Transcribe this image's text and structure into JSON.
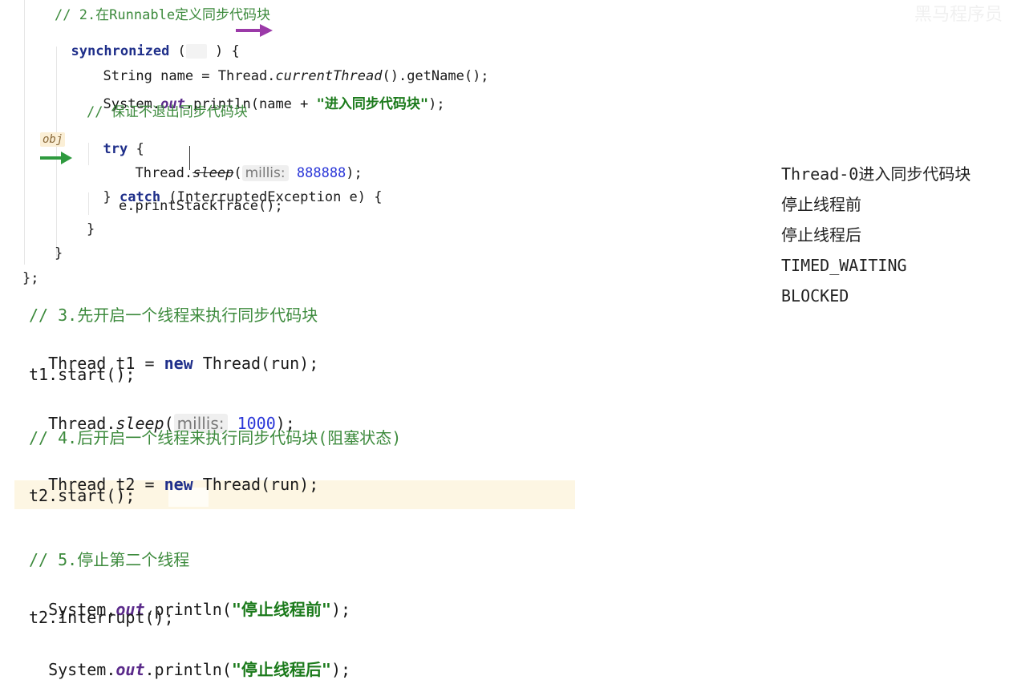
{
  "watermark": "黑马程序员",
  "gutter": {
    "obj_tag": "obj"
  },
  "code_top": {
    "comment2": "// 2.在Runnable定义同步代码块",
    "sync_kw": "synchronized",
    "sync_open": " (",
    "sync_close": " ) {",
    "l_string": "String name = Thread.",
    "l_current": "currentThread",
    "l_getname": "().getName();",
    "l_system": "System.",
    "l_out": "out",
    "l_println": ".println(name + ",
    "l_str_enter": "\"进入同步代码块\"",
    "l_close_paren": ");",
    "comment_keep": "// 保证不退出同步代码块",
    "try_kw": "try",
    "try_brace": " {",
    "thread_sleep": "Thread.",
    "sleep": "sleep",
    "paren_open": "(",
    "hint_millis": "millis:",
    "sleep_num": "888888",
    "close_semicolon": ");",
    "catch_close": "} ",
    "catch_kw": "catch",
    "catch_args": " (InterruptedException e) {",
    "print_stack": "e.printStackTrace();",
    "brace1": "}",
    "brace2": "}",
    "end": "};"
  },
  "code_bottom": {
    "comment3": "// 3.先开启一个线程来执行同步代码块",
    "t1_a": "Thread t1 = ",
    "t1_new": "new",
    "t1_b": " Thread(run);",
    "t1_start": "t1.start();",
    "sleep_a": "Thread.",
    "sleep_b": "sleep",
    "sleep_c": "(",
    "sleep_hint": "millis:",
    "sleep_num": "1000",
    "sleep_d": ");",
    "comment4": "// 4.后开启一个线程来执行同步代码块(阻塞状态)",
    "t2_a": "Thread t2 = ",
    "t2_new": "new",
    "t2_b": " Thread(run);",
    "t2_start": "t2.start();",
    "comment5": "// 5.停止第二个线程",
    "p1_a": "System.",
    "p1_out": "out",
    "p1_b": ".println(",
    "p1_str": "\"停止线程前\"",
    "p1_c": ");",
    "interrupt": "t2.interrupt();",
    "p2_a": "System.",
    "p2_out": "out",
    "p2_b": ".println(",
    "p2_str": "\"停止线程后\"",
    "p2_c": ");"
  },
  "console_output": [
    "Thread-0进入同步代码块",
    "停止线程前",
    "停止线程后",
    "TIMED_WAITING",
    "BLOCKED"
  ],
  "colors": {
    "comment": "#3c8a3c",
    "keyword": "#1f2f8a",
    "string": "#1b7a1b",
    "number": "#2a36d8",
    "arrow_green": "#2e9a3e",
    "arrow_purple": "#9b3aa8",
    "current_line": "#fdf6e3"
  }
}
